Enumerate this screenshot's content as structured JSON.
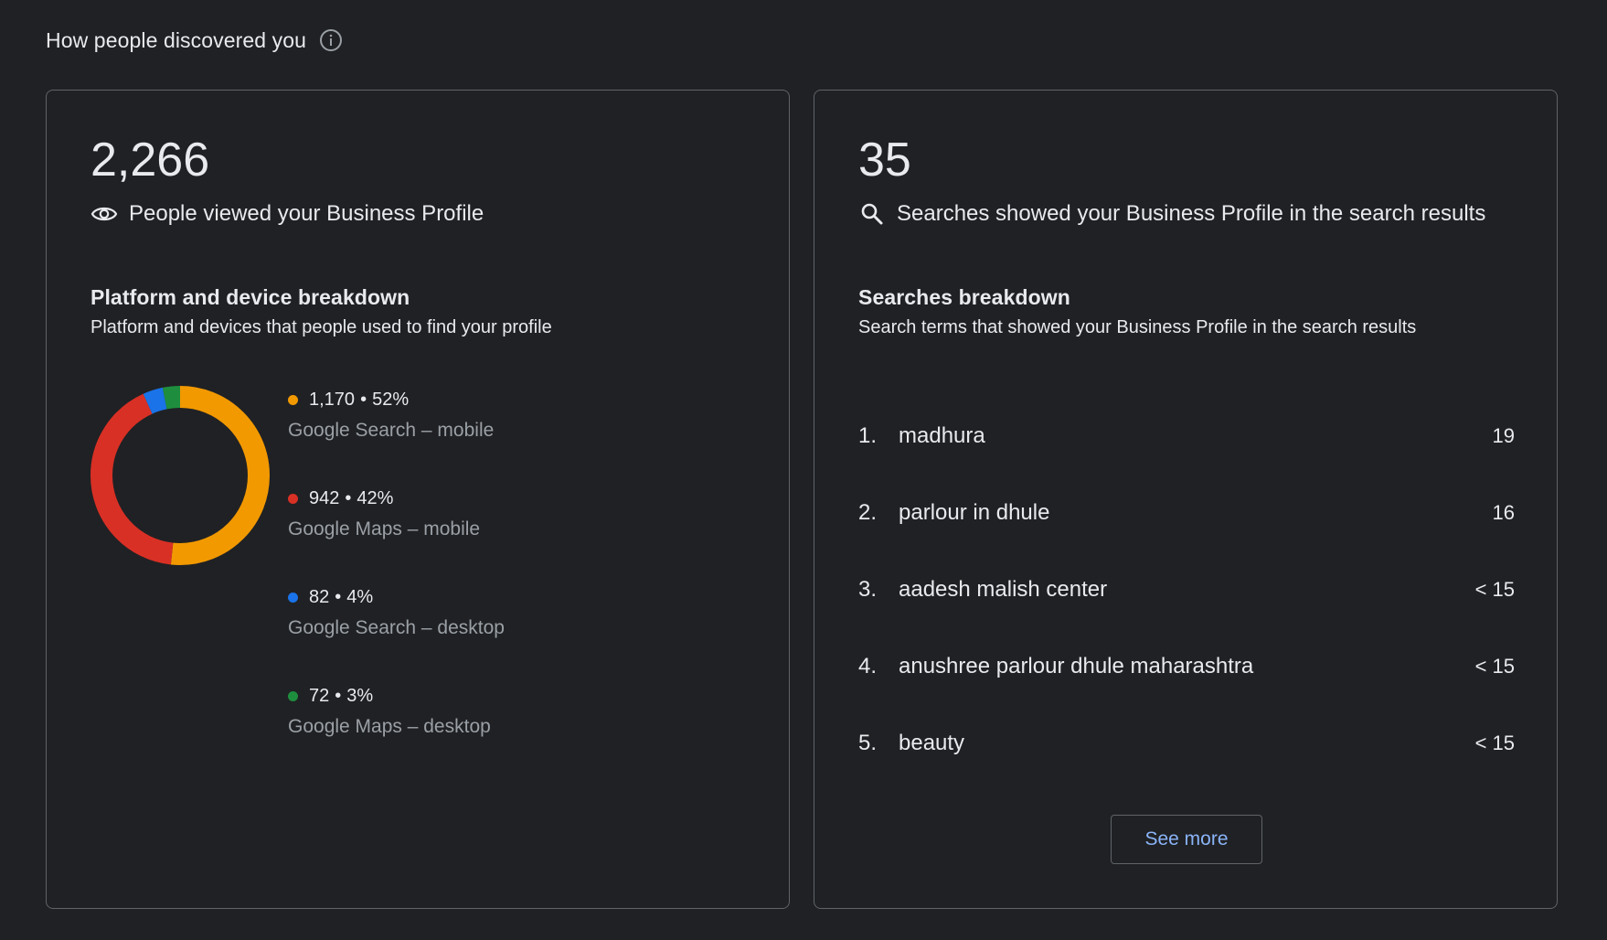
{
  "section": {
    "title": "How people discovered you"
  },
  "profile_views": {
    "count": "2,266",
    "label": "People viewed your Business Profile",
    "breakdown_title": "Platform and device breakdown",
    "breakdown_subtitle": "Platform and devices that people used to find your profile",
    "legend": [
      {
        "value": "1,170",
        "percent": "52%",
        "label": "Google Search – mobile",
        "color": "#f29900"
      },
      {
        "value": "942",
        "percent": "42%",
        "label": "Google Maps – mobile",
        "color": "#d93025"
      },
      {
        "value": "82",
        "percent": "4%",
        "label": "Google Search – desktop",
        "color": "#1a73e8"
      },
      {
        "value": "72",
        "percent": "3%",
        "label": "Google Maps – desktop",
        "color": "#1e8e3e"
      }
    ]
  },
  "chart_data": {
    "type": "pie",
    "donut": true,
    "categories": [
      "Google Search – mobile",
      "Google Maps – mobile",
      "Google Search – desktop",
      "Google Maps – desktop"
    ],
    "values": [
      1170,
      942,
      82,
      72
    ],
    "colors": [
      "#f29900",
      "#d93025",
      "#1a73e8",
      "#1e8e3e"
    ]
  },
  "searches": {
    "count": "35",
    "label": "Searches showed your Business Profile in the search results",
    "breakdown_title": "Searches breakdown",
    "breakdown_subtitle": "Search terms that showed your Business Profile in the search results",
    "items": [
      {
        "rank": "1.",
        "term": "madhura",
        "count": "19"
      },
      {
        "rank": "2.",
        "term": "parlour in dhule",
        "count": "16"
      },
      {
        "rank": "3.",
        "term": "aadesh malish center",
        "count": "< 15"
      },
      {
        "rank": "4.",
        "term": "anushree parlour dhule maharashtra",
        "count": "< 15"
      },
      {
        "rank": "5.",
        "term": "beauty",
        "count": "< 15"
      }
    ],
    "see_more_label": "See more"
  },
  "icons": {
    "info": "info-icon",
    "views": "eye-icon",
    "search": "search-icon"
  }
}
